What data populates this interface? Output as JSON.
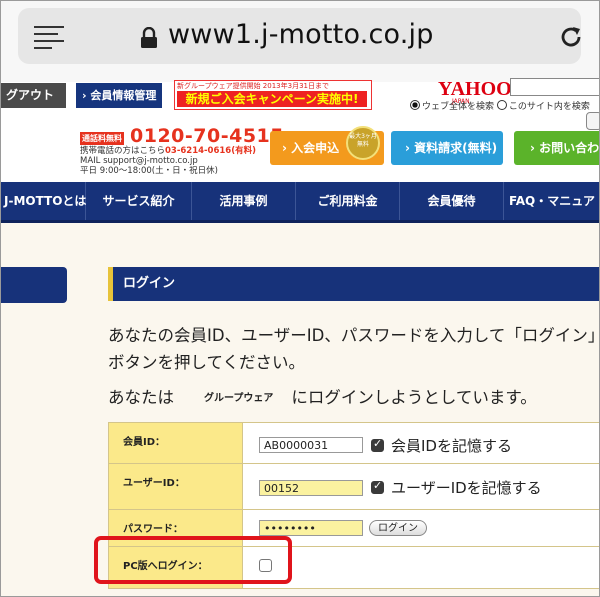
{
  "browser": {
    "url": "www1.j-motto.co.jp"
  },
  "header": {
    "logout_label": "グアウト",
    "member_mgmt_label": "会員情報管理",
    "banner_top": "新グループウェア提供開始 2013年3月31日まで",
    "banner_main": "新規ご入会キャンペーン実施中!",
    "yahoo_logo": "YAHOO!",
    "yahoo_sub": "JAPAN",
    "search_scope_web": "ウェブ全体を検索",
    "search_scope_site": "このサイト内を検索",
    "tel_label": "通話料無料",
    "tel_number": "0120-70-4515",
    "tel_mobile_prefix": "携帯電話の方はこちら",
    "tel_mobile": "03-6214-0616(有料)",
    "tel_mail": "MAIL support@j-motto.co.jp",
    "tel_hours": "平日 9:00～18:00(土・日・祝日休)",
    "join_label": "入会申込",
    "badge_text": "最大3ヶ月無料",
    "docs_label": "資料請求(無料)",
    "contact_label": "お問い合わせ"
  },
  "nav": {
    "items": [
      "J-MOTTOとは",
      "サービス紹介",
      "活用事例",
      "ご利用料金",
      "会員優待",
      "FAQ・マニュア"
    ]
  },
  "login": {
    "section_title": "ログイン",
    "instructions": "あなたの会員ID、ユーザーID、パスワードを入力して「ログイン」ボタンを押してください。",
    "target_prefix": "あなたは",
    "target_app": "グループウェア",
    "target_suffix": "にログインしようとしています。",
    "member_id_label": "会員ID：",
    "member_id_value": "AB0000031",
    "remember_member_label": "会員IDを記憶する",
    "user_id_label": "ユーザーID：",
    "user_id_value": "00152",
    "remember_user_label": "ユーザーIDを記憶する",
    "password_label": "パスワード：",
    "password_value": "••••••••",
    "login_button": "ログイン",
    "pc_login_label": "PC版へログイン："
  },
  "colors": {
    "nav": "#17327a",
    "label_bg": "#fbe98a",
    "highlight": "#e0141b"
  }
}
